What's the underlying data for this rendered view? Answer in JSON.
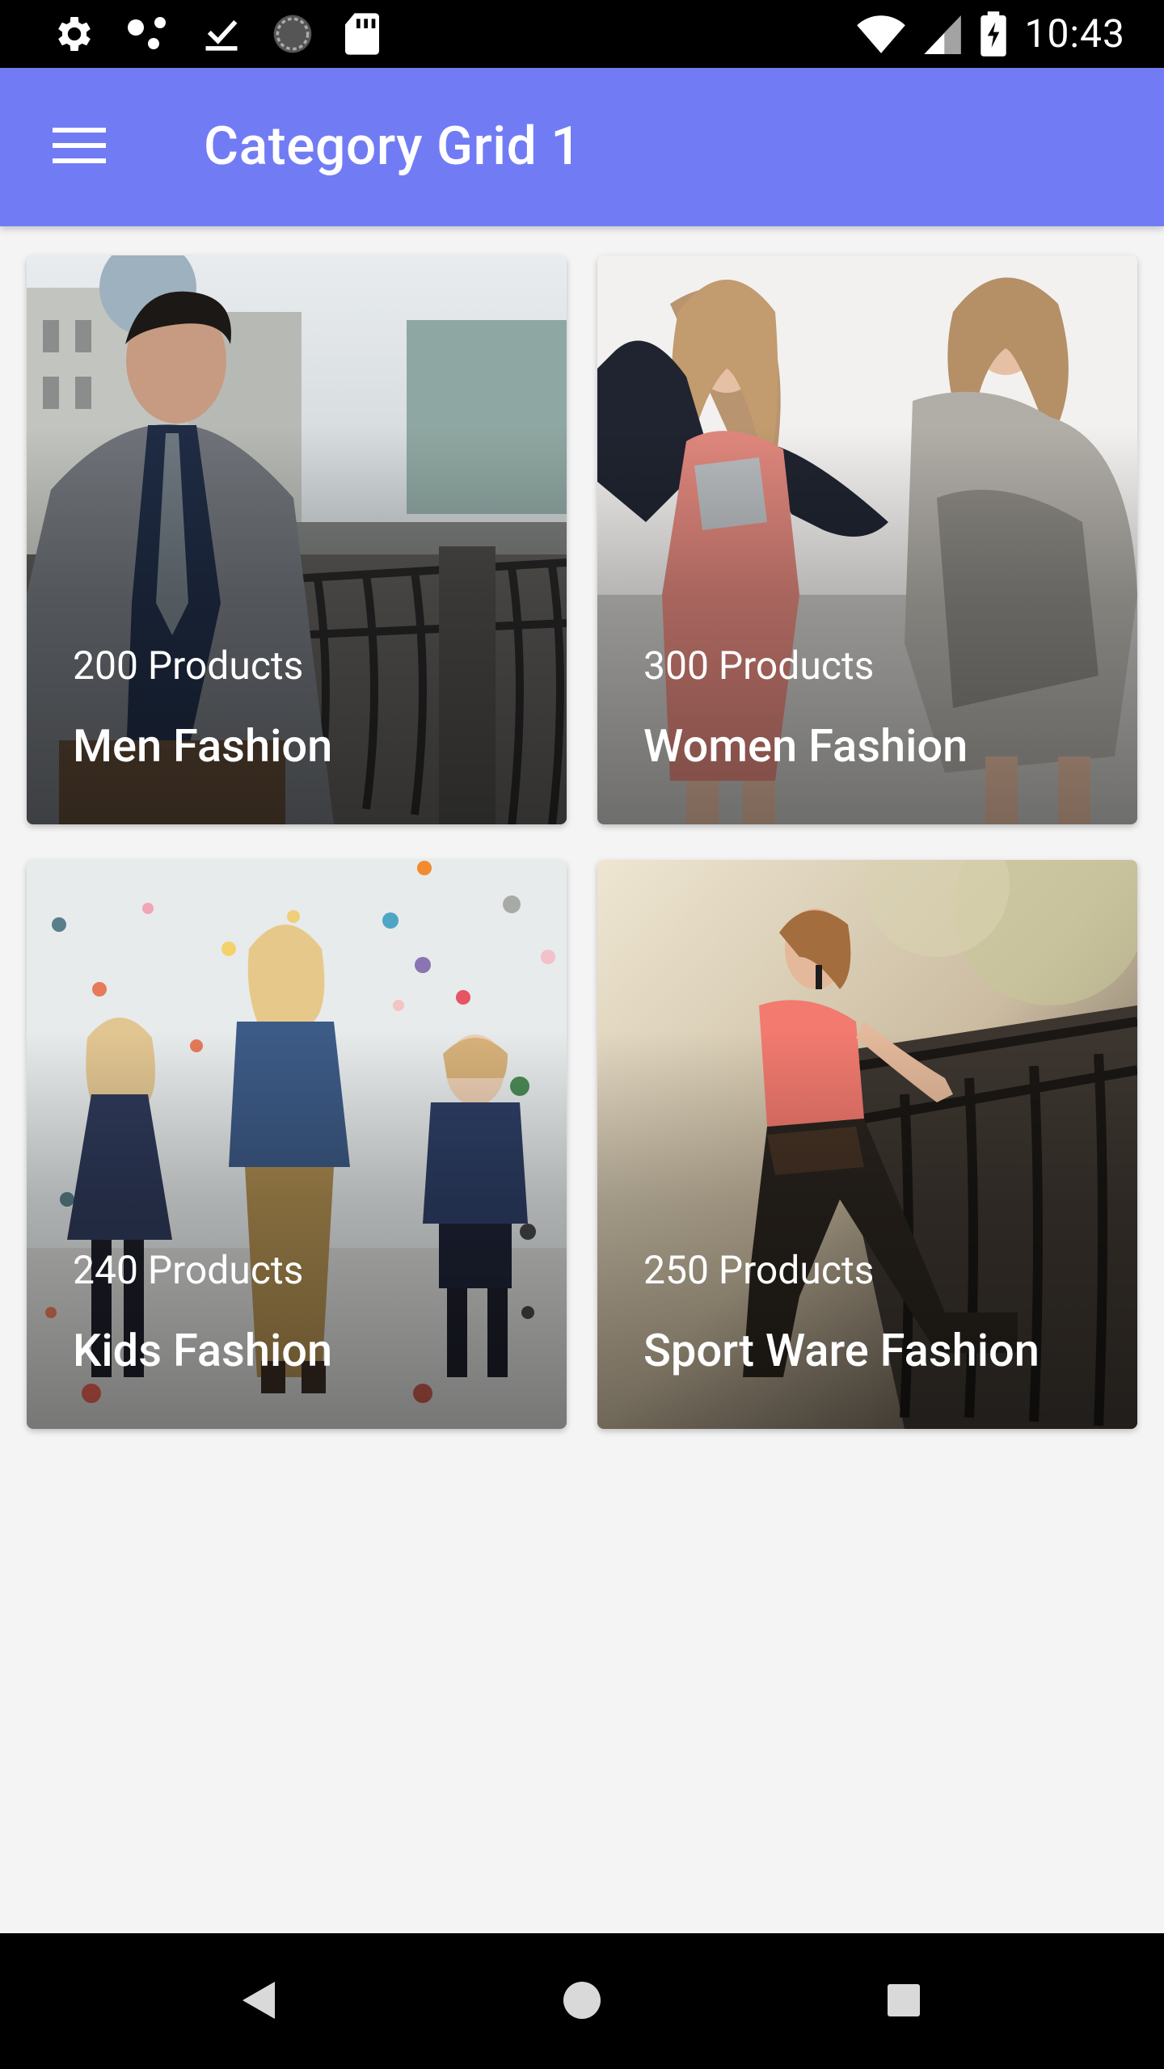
{
  "status_bar": {
    "time": "10:43",
    "left_icons": [
      "settings-icon",
      "dots-icon",
      "download-done-icon",
      "sync-circle-icon",
      "sd-card-icon"
    ],
    "right_icons": [
      "wifi-icon",
      "cell-signal-icon",
      "battery-charging-icon"
    ]
  },
  "app_bar": {
    "title": "Category Grid 1",
    "menu_icon": "menu-icon",
    "background": "#717cf4"
  },
  "categories": [
    {
      "count": "200 Products",
      "title": "Men Fashion"
    },
    {
      "count": "300 Products",
      "title": "Women Fashion"
    },
    {
      "count": "240 Products",
      "title": "Kids Fashion"
    },
    {
      "count": "250 Products",
      "title": "Sport Ware Fashion"
    }
  ],
  "nav_bar": {
    "buttons": [
      "back-icon",
      "home-icon",
      "recents-icon"
    ]
  }
}
